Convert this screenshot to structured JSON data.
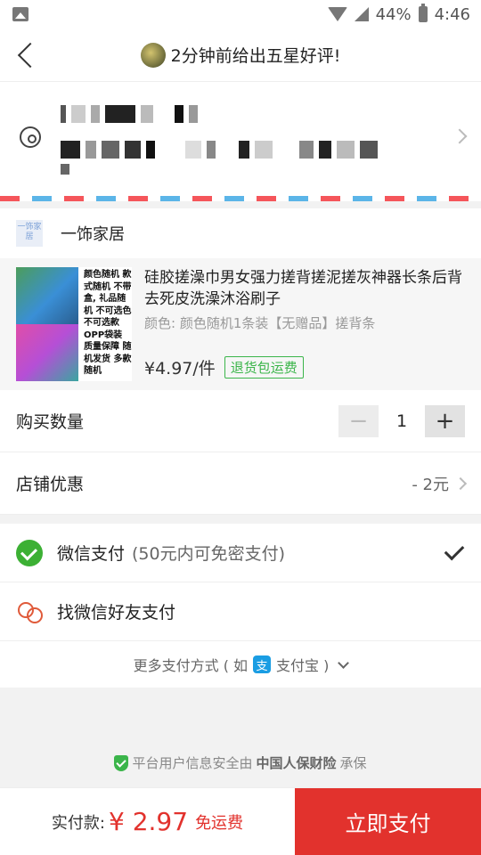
{
  "status_bar": {
    "battery": "44%",
    "time": "4:46"
  },
  "nav": {
    "title": "2分钟前给出五星好评!"
  },
  "shop": {
    "logo_text": "一饰家居",
    "name": "一饰家居"
  },
  "product": {
    "thumb_text": "颜色随机 款式随机 不带盒, 礼品随机 不可选色 不可选款 OPP袋装 质量保障 随机发货 多款随机",
    "title": "硅胶搓澡巾男女强力搓背搓泥搓灰神器长条后背去死皮洗澡沐浴刷子",
    "spec": "颜色: 颜色随机1条装【无赠品】搓背条",
    "price": "¥4.97/件",
    "badge": "退货包运费"
  },
  "quantity": {
    "label": "购买数量",
    "value": "1",
    "minus": "−",
    "plus": "+"
  },
  "discount": {
    "label": "店铺优惠",
    "value": "- 2元"
  },
  "payment": {
    "wechat_label": "微信支付",
    "wechat_note": "(50元内可免密支付)",
    "friend_label": "找微信好友支付",
    "more_prefix": "更多支付方式 ( 如",
    "alipay_icon": "支",
    "alipay_label": "支付宝 )"
  },
  "security": {
    "prefix": "平台用户信息安全由",
    "insurer": "中国人保财险",
    "suffix": "承保"
  },
  "bottom": {
    "total_label": "实付款:",
    "total_amount": "¥ 2.97",
    "free_shipping": "免运费",
    "pay_button": "立即支付"
  },
  "colors": {
    "accent": "#e2322d",
    "wechat_green": "#3cb034",
    "badge_green": "#3bb54a",
    "alipay_blue": "#1a9de3"
  }
}
